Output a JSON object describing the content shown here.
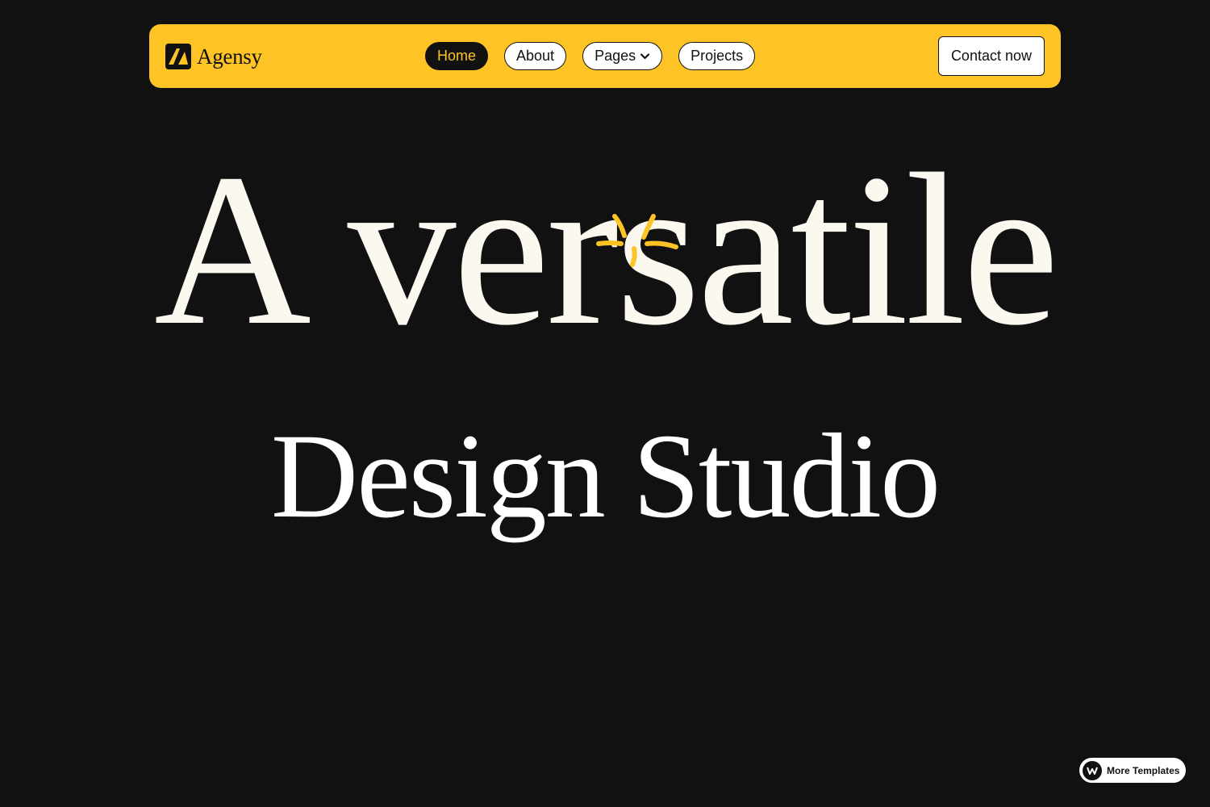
{
  "colors": {
    "background": "#111111",
    "accent": "#FEC425",
    "hero_text": "#FBF8F0",
    "white": "#FFFFFF"
  },
  "brand": {
    "name": "Agensy",
    "logo_icon": "agensy-logo-icon"
  },
  "nav": {
    "items": [
      {
        "label": "Home",
        "active": true
      },
      {
        "label": "About",
        "active": false
      },
      {
        "label": "Pages",
        "active": false,
        "icon": "chevron-down-icon"
      },
      {
        "label": "Projects",
        "active": false
      }
    ],
    "cta_label": "Contact now"
  },
  "hero": {
    "line1": "A versatile",
    "line2": "Design Studio",
    "decoration_icon": "sparkle-icon"
  },
  "badge": {
    "label": "More Templates",
    "icon": "webflow-icon"
  }
}
